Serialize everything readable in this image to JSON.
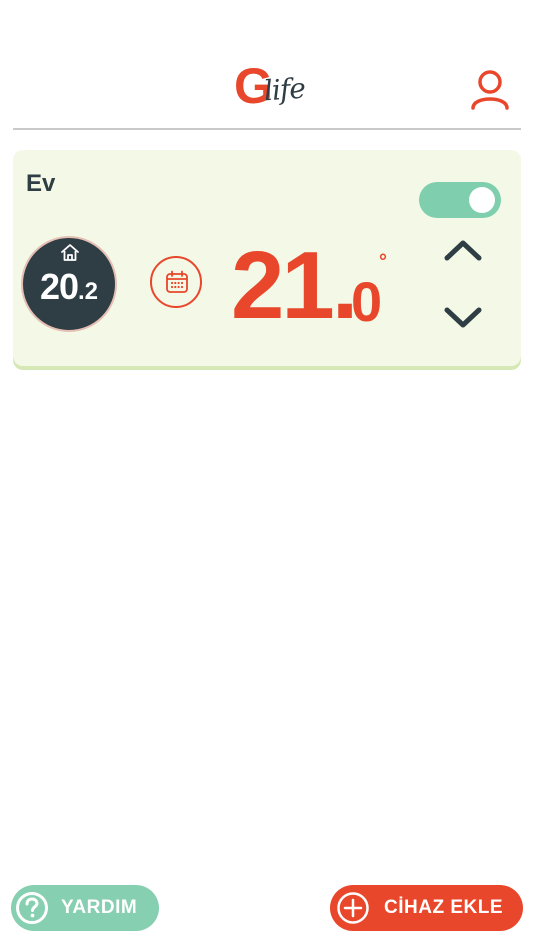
{
  "header": {
    "logo_initial": "G",
    "logo_word": "life",
    "profile_icon": "user-icon",
    "accent_color": "#e8472b"
  },
  "device": {
    "name": "Ev",
    "power_on": true,
    "current_icon": "home-icon",
    "current_temp_int": "20",
    "current_temp_dec": ".2",
    "schedule_icon": "calendar-icon",
    "setpoint_int": "21.",
    "setpoint_dec": "0",
    "setpoint_unit": "°",
    "increase_icon": "chevron-up-icon",
    "decrease_icon": "chevron-down-icon",
    "card_color": "#f3f9e6",
    "toggle_color": "#7fcfae",
    "current_bg_color": "#2f3d44"
  },
  "footer": {
    "help_label": "YARDIM",
    "help_icon": "question-icon",
    "help_color": "#86cfb0",
    "add_label": "CİHAZ EKLE",
    "add_icon": "plus-circle-icon",
    "add_color": "#e8472b"
  }
}
